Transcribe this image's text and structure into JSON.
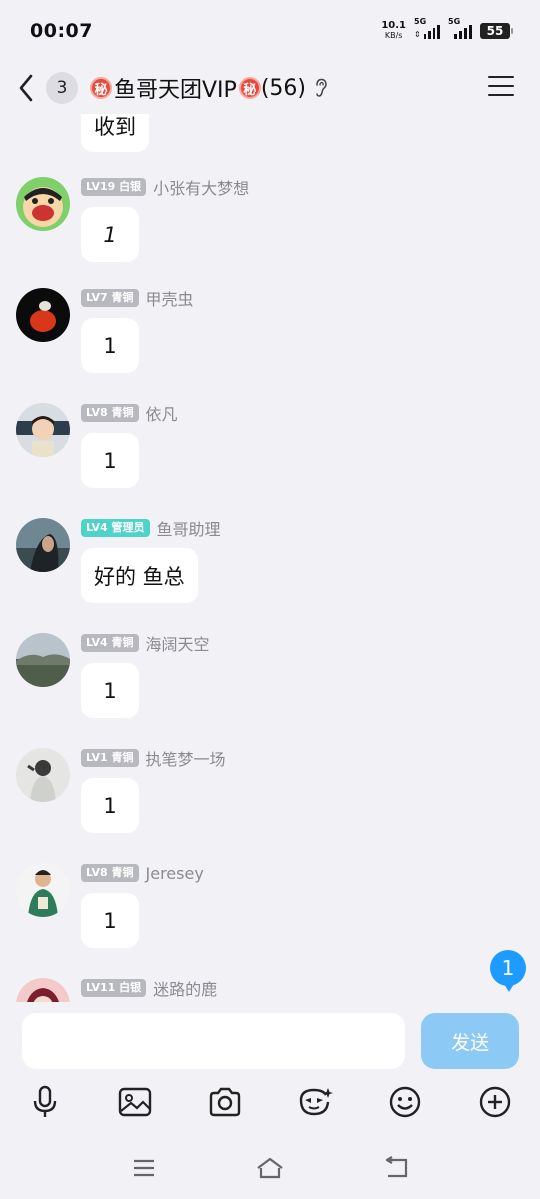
{
  "status": {
    "time": "00:07",
    "net_speed": "10.1",
    "net_unit": "KB/s",
    "sim1": "5G",
    "sim2": "5G",
    "battery": "55"
  },
  "header": {
    "unread_count": "3",
    "secret_badge": "秘",
    "group_name": "鱼哥天团VIP",
    "member_count": "(56)"
  },
  "messages": [
    {
      "level": "",
      "nickname": "",
      "text": "收到"
    },
    {
      "level": "LV19 白银",
      "nickname": "小张有大梦想",
      "text": "1",
      "italic": true
    },
    {
      "level": "LV7 青铜",
      "nickname": "甲壳虫",
      "text": "1"
    },
    {
      "level": "LV8 青铜",
      "nickname": "依凡",
      "text": "1"
    },
    {
      "level": "LV4 管理员",
      "nickname": "鱼哥助理",
      "text": "好的 鱼总",
      "admin": true
    },
    {
      "level": "LV4 青铜",
      "nickname": "海阔天空",
      "text": "1"
    },
    {
      "level": "LV1 青铜",
      "nickname": "执笔梦一场",
      "text": "1"
    },
    {
      "level": "LV8 青铜",
      "nickname": "Jeresey",
      "text": "1"
    },
    {
      "level": "LV11 白银",
      "nickname": "迷路的鹿",
      "text": ""
    }
  ],
  "new_message_badge": "1",
  "input": {
    "placeholder": "",
    "send_label": "发送"
  },
  "toolbar": [
    "microphone-icon",
    "image-icon",
    "camera-icon",
    "emoji-sticker-icon",
    "smiley-icon",
    "plus-icon"
  ],
  "nav": [
    "menu-icon",
    "home-icon",
    "back-icon"
  ],
  "colors": {
    "background": "#f2f2f6",
    "admin_badge": "#4fd2c8",
    "level_badge": "#b8b8bf",
    "send_button": "#8ccaf5",
    "unread_badge": "#1e9bff",
    "secret_badge": "#e64a3c"
  }
}
